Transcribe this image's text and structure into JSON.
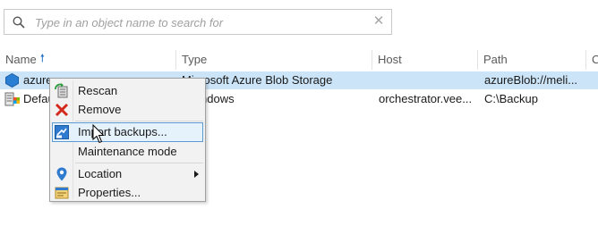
{
  "search": {
    "placeholder": "Type in an object name to search for",
    "icon": "search-icon",
    "clear_icon": "close-icon"
  },
  "grid": {
    "columns": [
      {
        "key": "name",
        "label": "Name",
        "sorted": "ascending"
      },
      {
        "key": "type",
        "label": "Type"
      },
      {
        "key": "host",
        "label": "Host"
      },
      {
        "key": "path",
        "label": "Path"
      },
      {
        "key": "extra",
        "label": "C"
      }
    ],
    "rows": [
      {
        "name": "azure",
        "type": "Microsoft Azure Blob Storage",
        "host": "",
        "path": "azureBlob://meli...",
        "icon": "azure-repository-icon",
        "selected": true
      },
      {
        "name": "Defau",
        "type": "ndows",
        "host": "orchestrator.vee...",
        "path": "C:\\Backup",
        "icon": "backup-repository-icon",
        "selected": false
      }
    ]
  },
  "context_menu": {
    "items": [
      {
        "label": "Rescan",
        "icon": "rescan-icon"
      },
      {
        "label": "Remove",
        "icon": "remove-icon"
      },
      {
        "label": "Import backups...",
        "icon": "import-backups-icon",
        "hovered": true
      },
      {
        "label": "Maintenance mode",
        "icon": ""
      },
      {
        "label": "Location",
        "icon": "location-pin-icon",
        "submenu": true
      },
      {
        "label": "Properties...",
        "icon": "properties-icon"
      }
    ]
  },
  "colors": {
    "selection": "#cce4f7",
    "accent": "#1f6fc4",
    "menu_background": "#f2f2f2",
    "menu_hover_border": "#5b9bd5"
  }
}
